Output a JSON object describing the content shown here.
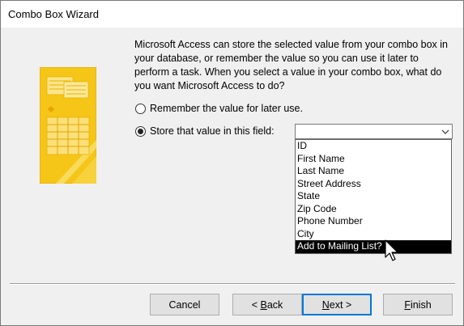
{
  "window": {
    "title": "Combo Box Wizard"
  },
  "instructions": "Microsoft Access can store the selected value from your combo box in your database, or remember the value so you can use it later to perform a task.  When you select a value in your combo box, what do you want Microsoft Access to do?",
  "options": [
    {
      "label": "Remember the value for later use.",
      "checked": false
    },
    {
      "label": "Store that value in this field:",
      "checked": true
    }
  ],
  "field_combo": {
    "value": "",
    "items": [
      "ID",
      "First Name",
      "Last Name",
      "Street Address",
      "State",
      "Zip Code",
      "Phone Number",
      "City",
      "Add to Mailing List?"
    ],
    "highlighted_index": 8
  },
  "buttons": {
    "cancel": "Cancel",
    "back_prefix": "< ",
    "back_mnemonic": "B",
    "back_rest": "ack",
    "next_mnemonic": "N",
    "next_rest": "ext >",
    "finish_mnemonic": "F",
    "finish_rest": "inish"
  },
  "colors": {
    "illustration_bg": "#f5c518",
    "illustration_dark": "#e3a500",
    "selection_bg": "#000000",
    "default_button_border": "#0078d7"
  },
  "icons": [
    "combo-arrow-icon",
    "mouse-pointer-icon",
    "wizard-illustration"
  ]
}
